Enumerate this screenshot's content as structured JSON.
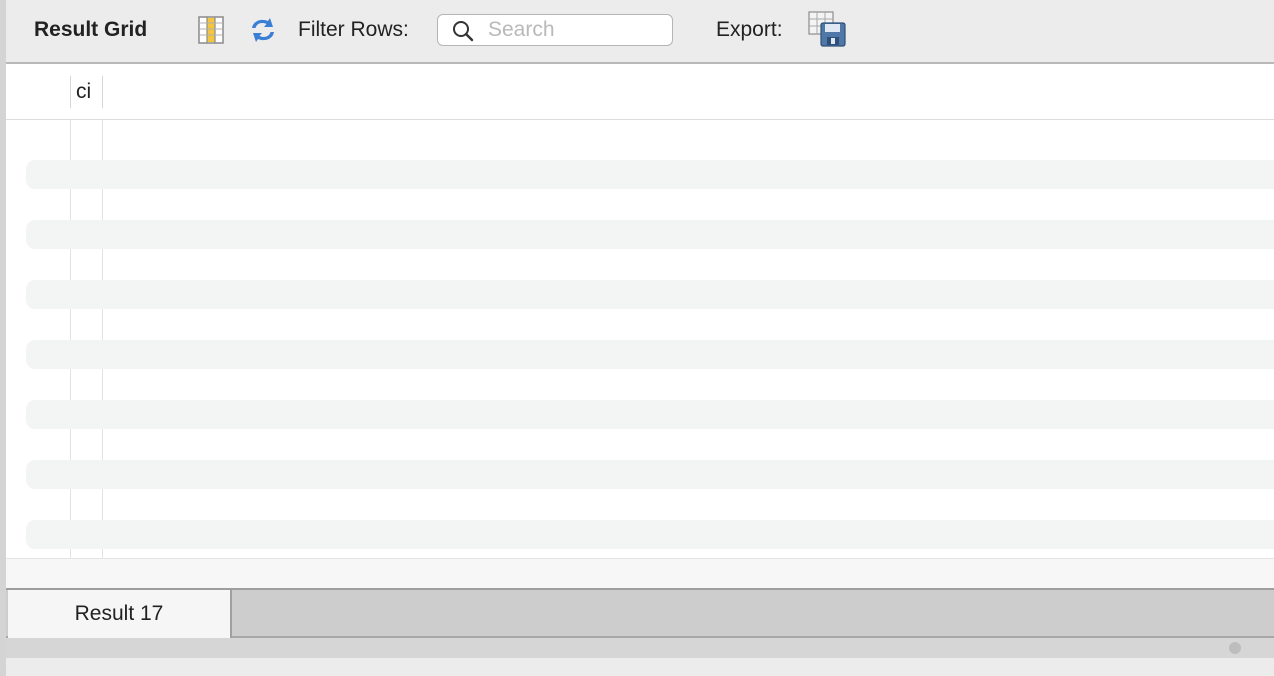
{
  "toolbar": {
    "title": "Result Grid",
    "columns_icon": "column-toggle-icon",
    "refresh_icon": "refresh-icon",
    "filter_label": "Filter Rows:",
    "search_placeholder": "Search",
    "search_value": "",
    "export_label": "Export:",
    "export_icon": "export-save-icon"
  },
  "grid": {
    "columns": [
      "ci"
    ],
    "rows": []
  },
  "tabs": [
    {
      "label": "Result 17",
      "active": true
    }
  ],
  "colors": {
    "toolbar_bg": "#ececec",
    "grid_bg": "#ffffff",
    "row_stripe": "#f3f4f4",
    "tab_bar_bg": "#cdcdcd",
    "active_tab_bg": "#f6f6f6",
    "refresh_blue": "#3a7fd5",
    "column_icon_yellow": "#f5c542"
  }
}
